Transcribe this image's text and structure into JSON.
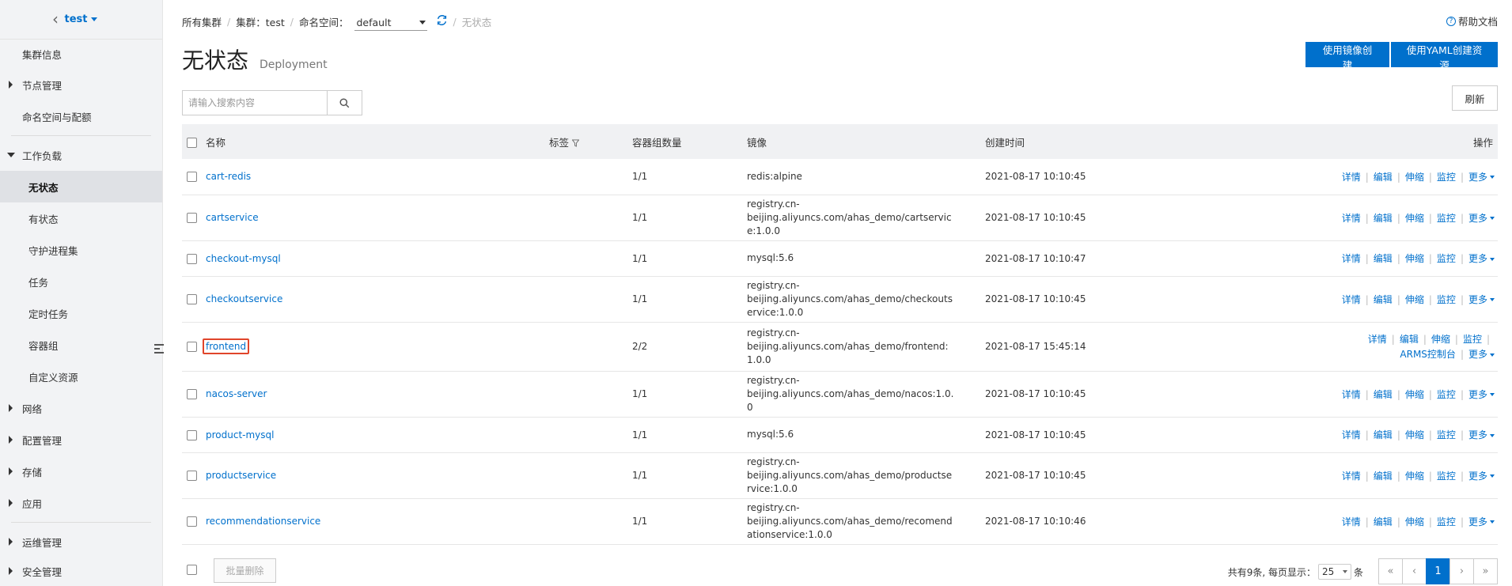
{
  "sidebar": {
    "cluster_name": "test",
    "items": [
      {
        "label": "集群信息"
      },
      {
        "label": "节点管理"
      },
      {
        "label": "命名空间与配额"
      },
      {
        "label": "工作负载"
      },
      {
        "label": "无状态"
      },
      {
        "label": "有状态"
      },
      {
        "label": "守护进程集"
      },
      {
        "label": "任务"
      },
      {
        "label": "定时任务"
      },
      {
        "label": "容器组"
      },
      {
        "label": "自定义资源"
      },
      {
        "label": "网络"
      },
      {
        "label": "配置管理"
      },
      {
        "label": "存储"
      },
      {
        "label": "应用"
      },
      {
        "label": "运维管理"
      },
      {
        "label": "安全管理"
      }
    ]
  },
  "breadcrumb": {
    "all_clusters": "所有集群",
    "cluster": "集群：test",
    "namespace_label": "命名空间：",
    "namespace_value": "default",
    "current": "无状态"
  },
  "header": {
    "help": "帮助文档",
    "title": "无状态",
    "subtitle": "Deployment",
    "create_image_button": "使用镜像创建",
    "create_yaml_button": "使用YAML创建资源",
    "refresh_button": "刷新"
  },
  "search": {
    "placeholder": "请输入搜索内容"
  },
  "table": {
    "headers": {
      "name": "名称",
      "labels": "标签",
      "pods": "容器组数量",
      "image": "镜像",
      "created": "创建时间",
      "actions": "操作"
    },
    "actions": {
      "detail": "详情",
      "edit": "编辑",
      "scale": "伸缩",
      "monitor": "监控",
      "more": "更多",
      "arms": "ARMS控制台"
    },
    "rows": [
      {
        "name": "cart-redis",
        "pods": "1/1",
        "image_l1": "redis:alpine",
        "image_l2": "",
        "created": "2021-08-17 10:10:45"
      },
      {
        "name": "cartservice",
        "pods": "1/1",
        "image_l1": "registry.cn-beijing.aliyuncs.com/ahas_demo/cartservic",
        "image_l2": "e:1.0.0",
        "created": "2021-08-17 10:10:45"
      },
      {
        "name": "checkout-mysql",
        "pods": "1/1",
        "image_l1": "mysql:5.6",
        "image_l2": "",
        "created": "2021-08-17 10:10:47"
      },
      {
        "name": "checkoutservice",
        "pods": "1/1",
        "image_l1": "registry.cn-beijing.aliyuncs.com/ahas_demo/checkouts",
        "image_l2": "ervice:1.0.0",
        "created": "2021-08-17 10:10:45"
      },
      {
        "name": "frontend",
        "pods": "2/2",
        "image_l1": "registry.cn-beijing.aliyuncs.com/ahas_demo/frontend:",
        "image_l2": "1.0.0",
        "created": "2021-08-17 15:45:14"
      },
      {
        "name": "nacos-server",
        "pods": "1/1",
        "image_l1": "registry.cn-beijing.aliyuncs.com/ahas_demo/nacos:1.0.",
        "image_l2": "0",
        "created": "2021-08-17 10:10:45"
      },
      {
        "name": "product-mysql",
        "pods": "1/1",
        "image_l1": "mysql:5.6",
        "image_l2": "",
        "created": "2021-08-17 10:10:45"
      },
      {
        "name": "productservice",
        "pods": "1/1",
        "image_l1": "registry.cn-beijing.aliyuncs.com/ahas_demo/productse",
        "image_l2": "rvice:1.0.0",
        "created": "2021-08-17 10:10:45"
      },
      {
        "name": "recommendationservice",
        "pods": "1/1",
        "image_l1": "registry.cn-beijing.aliyuncs.com/ahas_demo/recomend",
        "image_l2": "ationservice:1.0.0",
        "created": "2021-08-17 10:10:46"
      }
    ]
  },
  "footer": {
    "batch_delete": "批量删除",
    "total_text": "共有9条, 每页显示：",
    "page_size": "25",
    "unit": "条",
    "pages": {
      "first": "«",
      "prev": "‹",
      "current": "1",
      "next": "›",
      "last": "»"
    }
  },
  "colors": {
    "accent": "#0070cc",
    "highlight_border": "#e0452b"
  }
}
